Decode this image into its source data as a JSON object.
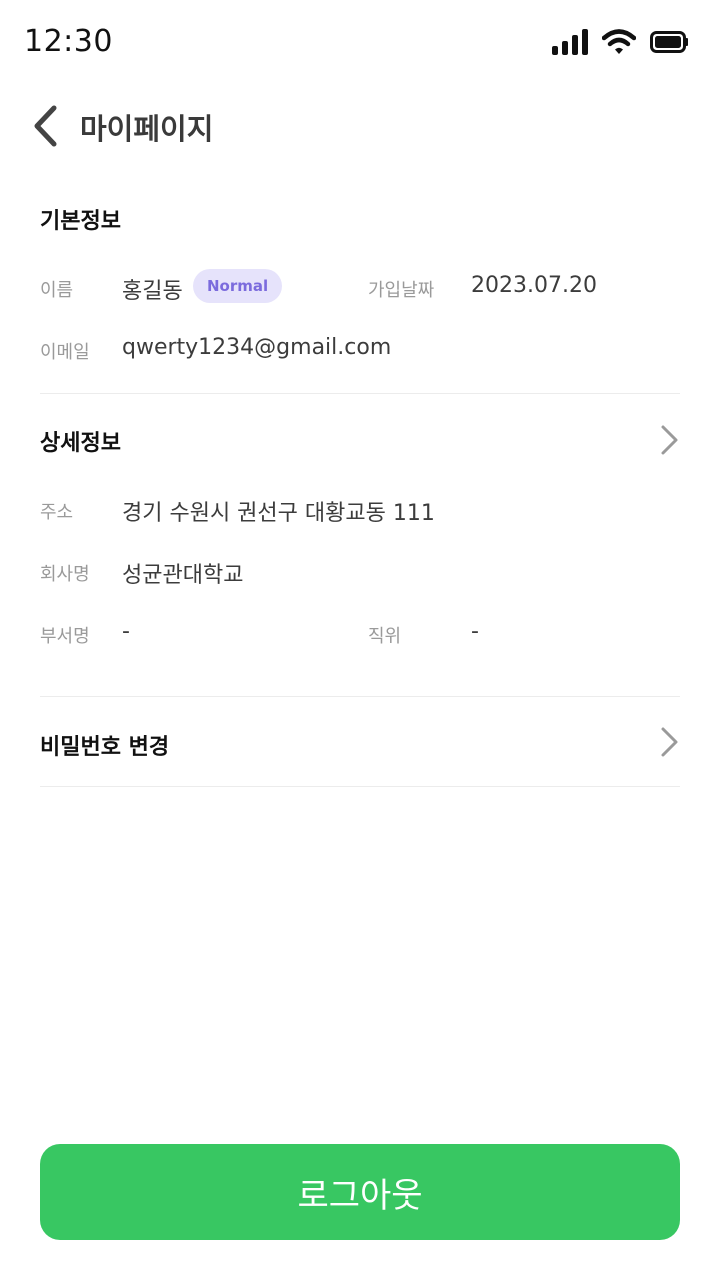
{
  "status_bar": {
    "time": "12:30"
  },
  "header": {
    "title": "마이페이지"
  },
  "basic_info": {
    "title": "기본정보",
    "name_label": "이름",
    "name_value": "홍길동",
    "badge": "Normal",
    "join_label": "가입날짜",
    "join_value": "2023.07.20",
    "email_label": "이메일",
    "email_value": "qwerty1234@gmail.com"
  },
  "detail_info": {
    "title": "상세정보",
    "address_label": "주소",
    "address_value": "경기 수원시 권선구 대황교동 111",
    "company_label": "회사명",
    "company_value": "성균관대학교",
    "dept_label": "부서명",
    "dept_value": "-",
    "position_label": "직위",
    "position_value": "-"
  },
  "password": {
    "title": "비밀번호 변경"
  },
  "logout": {
    "label": "로그아웃"
  },
  "colors": {
    "accent": "#38c762",
    "badge_bg": "#e6e3fb",
    "badge_text": "#7b6bdd"
  }
}
